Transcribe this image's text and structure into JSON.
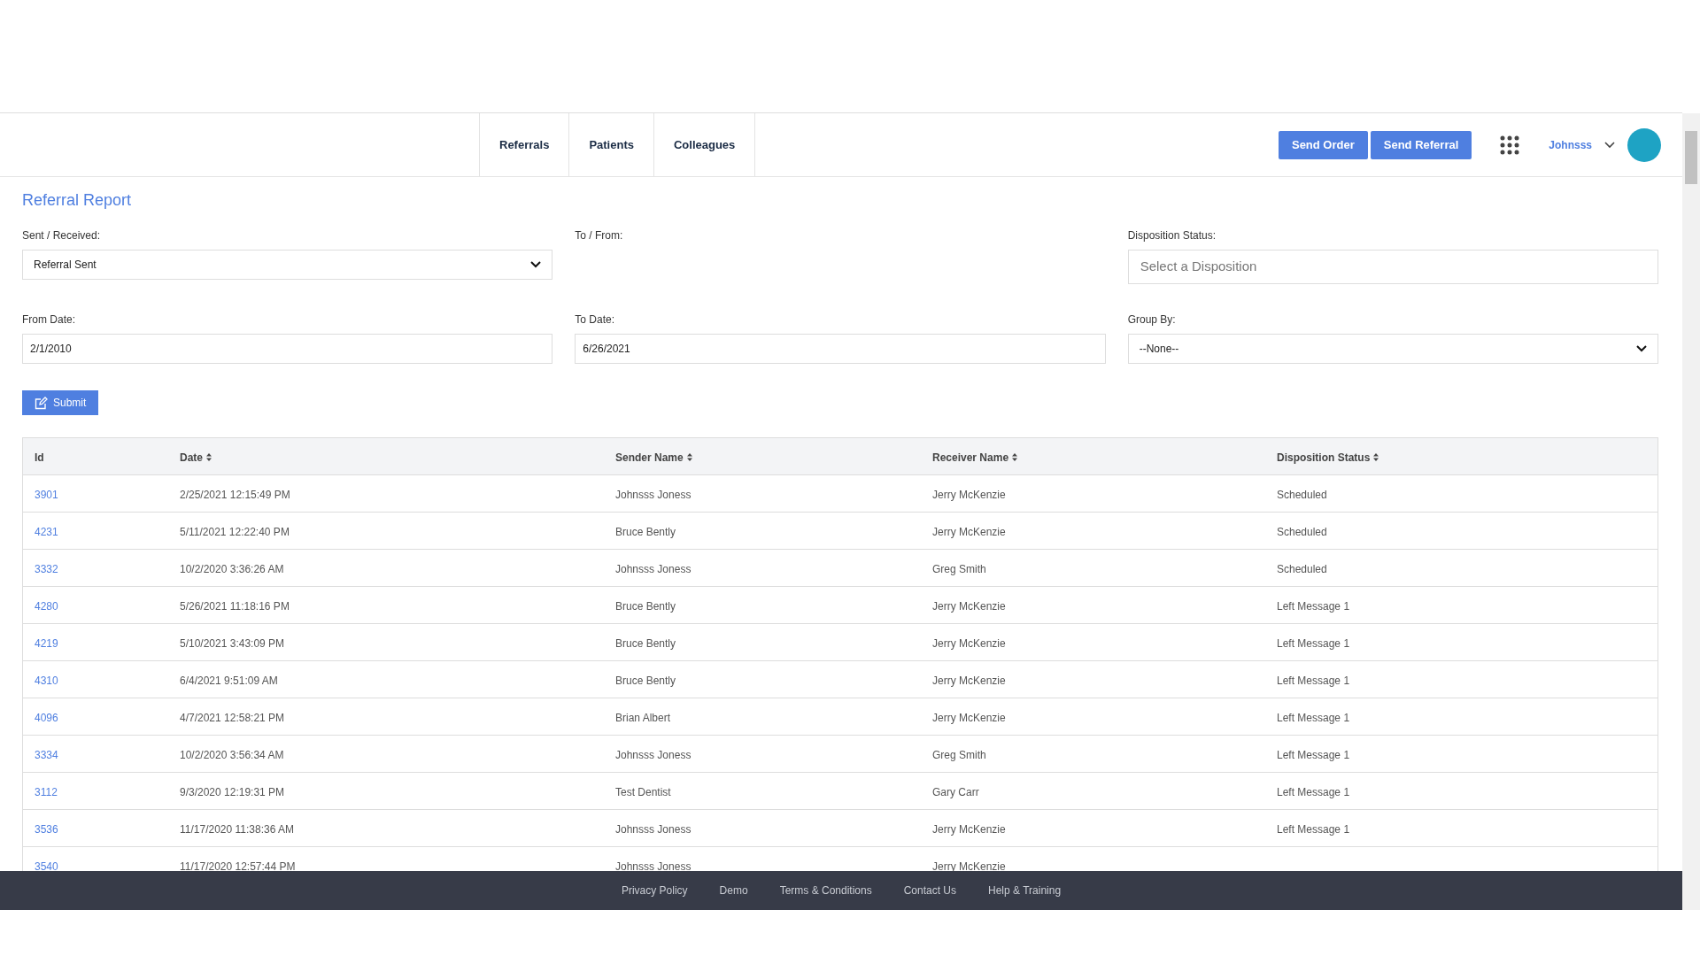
{
  "nav": {
    "tabs": [
      {
        "label": "Referrals"
      },
      {
        "label": "Patients"
      },
      {
        "label": "Colleagues"
      }
    ],
    "buttons": [
      "Send Order",
      "Send Referral"
    ],
    "user": "Johnsss"
  },
  "page_title": "Referral Report",
  "filters": [
    {
      "kind": "select",
      "label": "Sent / Received:",
      "value": "Referral Sent"
    },
    {
      "kind": "empty",
      "label": "To / From:"
    },
    {
      "kind": "search",
      "label": "Disposition Status:",
      "placeholder": "Select a Disposition"
    },
    {
      "kind": "input",
      "label": "From Date:",
      "value": "2/1/2010"
    },
    {
      "kind": "input",
      "label": "To Date:",
      "value": "6/26/2021"
    },
    {
      "kind": "select",
      "label": "Group By:",
      "value": "--None--"
    }
  ],
  "submit": "Submit",
  "table": {
    "columns": [
      {
        "label": "Id",
        "sortable": false
      },
      {
        "label": "Date",
        "sortable": true
      },
      {
        "label": "Sender Name",
        "sortable": true
      },
      {
        "label": "Receiver Name",
        "sortable": true
      },
      {
        "label": "Disposition Status",
        "sortable": true
      }
    ],
    "rows": [
      [
        "3901",
        "2/25/2021 12:15:49 PM",
        "Johnsss Joness",
        "Jerry McKenzie",
        "Scheduled"
      ],
      [
        "4231",
        "5/11/2021 12:22:40 PM",
        "Bruce Bently",
        "Jerry McKenzie",
        "Scheduled"
      ],
      [
        "3332",
        "10/2/2020 3:36:26 AM",
        "Johnsss Joness",
        "Greg Smith",
        "Scheduled"
      ],
      [
        "4280",
        "5/26/2021 11:18:16 PM",
        "Bruce Bently",
        "Jerry McKenzie",
        "Left Message 1"
      ],
      [
        "4219",
        "5/10/2021 3:43:09 PM",
        "Bruce Bently",
        "Jerry McKenzie",
        "Left Message 1"
      ],
      [
        "4310",
        "6/4/2021 9:51:09 AM",
        "Bruce Bently",
        "Jerry McKenzie",
        "Left Message 1"
      ],
      [
        "4096",
        "4/7/2021 12:58:21 PM",
        "Brian Albert",
        "Jerry McKenzie",
        "Left Message 1"
      ],
      [
        "3334",
        "10/2/2020 3:56:34 AM",
        "Johnsss Joness",
        "Greg Smith",
        "Left Message 1"
      ],
      [
        "3112",
        "9/3/2020 12:19:31 PM",
        "Test Dentist",
        "Gary Carr",
        "Left Message 1"
      ],
      [
        "3536",
        "11/17/2020 11:38:36 AM",
        "Johnsss Joness",
        "Jerry McKenzie",
        "Left Message 1"
      ],
      [
        "3540",
        "11/17/2020 12:57:44 PM",
        "Johnsss Joness",
        "Jerry McKenzie",
        ""
      ]
    ]
  },
  "footer": [
    "Privacy Policy",
    "Demo",
    "Terms & Conditions",
    "Contact Us",
    "Help & Training"
  ]
}
